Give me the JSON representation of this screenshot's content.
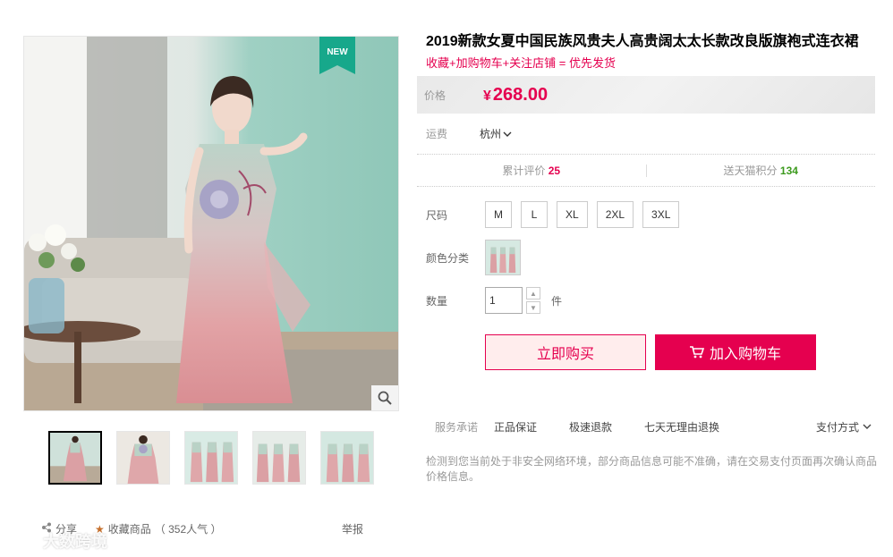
{
  "gallery": {
    "badge": "NEW",
    "badge_color": "#17a88b",
    "zoom_icon": "magnifier-icon",
    "thumbnails_count": 5
  },
  "actions": {
    "share_label": "分享",
    "favorite_label": "收藏商品",
    "popularity": "（ 352人气 ）",
    "report_label": "举报"
  },
  "watermark": {
    "text": "大数跨境"
  },
  "product": {
    "title": "2019新款女夏中国民族风贵夫人高贵阔太太长款改良版旗袍式连衣裙",
    "subtitle": "收藏+加购物车+关注店铺 = 优先发货",
    "price_label": "价格",
    "currency": "¥",
    "price": "268.00",
    "shipping_label": "运费",
    "shipping_from": "杭州",
    "reviews_label": "累计评价",
    "reviews_count": "25",
    "points_label": "送天猫积分",
    "points_count": "134"
  },
  "sku": {
    "size_label": "尺码",
    "sizes": [
      "M",
      "L",
      "XL",
      "2XL",
      "3XL"
    ],
    "color_label": "颜色分类",
    "qty_label": "数量",
    "qty_value": "1",
    "qty_unit": "件"
  },
  "buttons": {
    "buy_now": "立即购买",
    "add_to_cart": "加入购物车"
  },
  "service": {
    "label": "服务承诺",
    "items": [
      "正品保证",
      "极速退款",
      "七天无理由退换"
    ],
    "payment": "支付方式"
  },
  "warning": "检测到您当前处于非安全网络环境，部分商品信息可能不准确，请在交易支付页面再次确认商品价格信息。",
  "colors": {
    "accent": "#e5004f",
    "green": "#3c9a1d"
  }
}
